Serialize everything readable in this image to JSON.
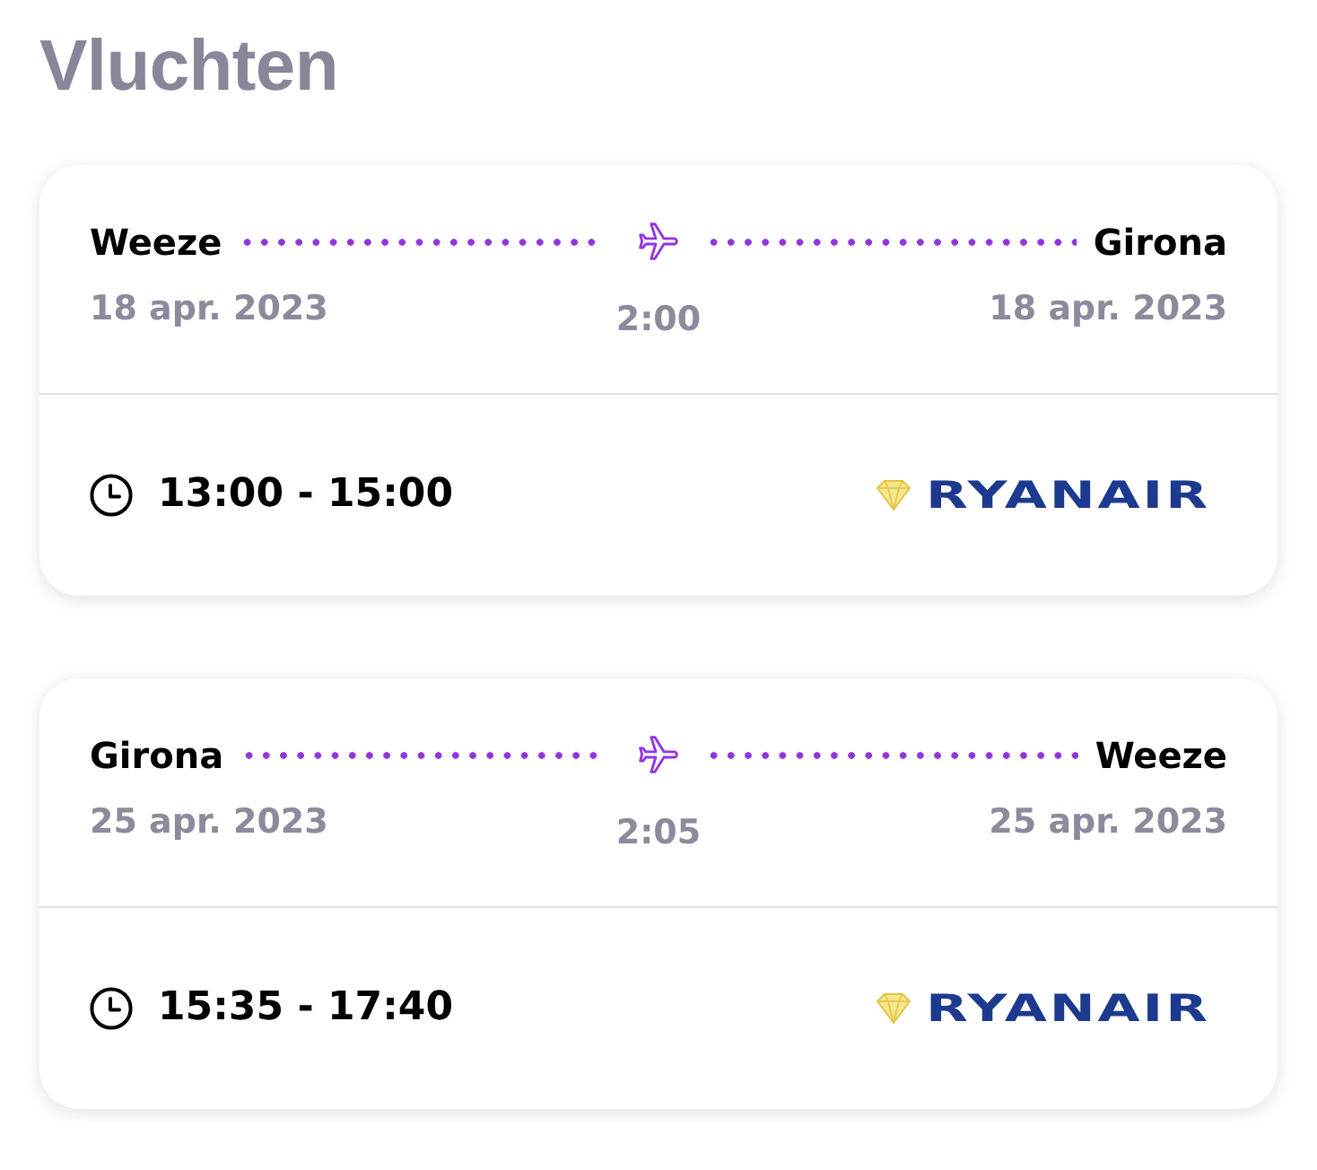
{
  "title": "Vluchten",
  "flights": [
    {
      "from": {
        "city": "Weeze",
        "date": "18 apr. 2023"
      },
      "to": {
        "city": "Girona",
        "date": "18 apr. 2023"
      },
      "duration": "2:00",
      "times": "13:00 - 15:00",
      "airline": "RYANAIR"
    },
    {
      "from": {
        "city": "Girona",
        "date": "25 apr. 2023"
      },
      "to": {
        "city": "Weeze",
        "date": "25 apr. 2023"
      },
      "duration": "2:05",
      "times": "15:35 - 17:40",
      "airline": "RYANAIR"
    }
  ]
}
